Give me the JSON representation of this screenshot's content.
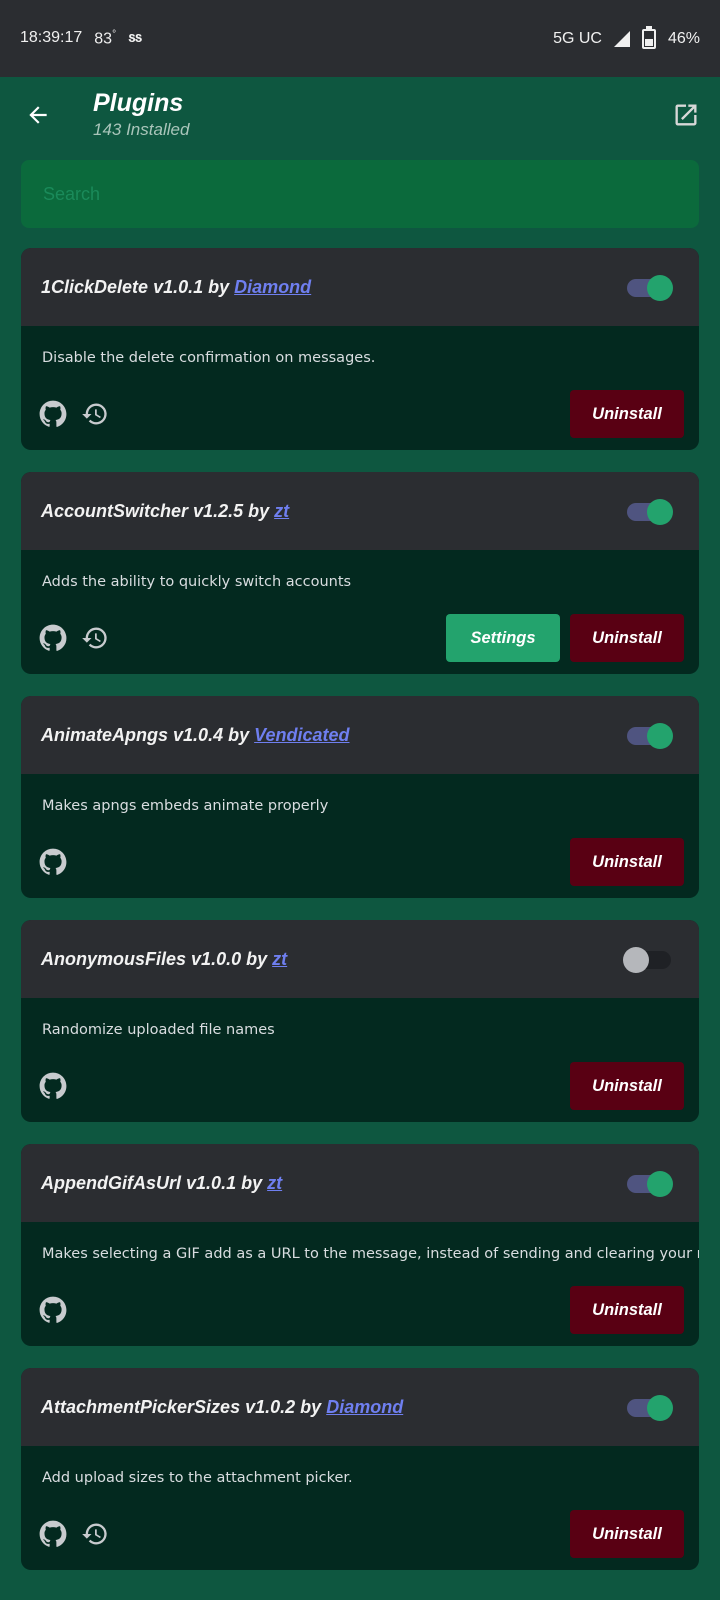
{
  "status_bar": {
    "time": "18:39:17",
    "temperature": "83",
    "degree": "°",
    "extra": "ՏՏ",
    "network": "5G UC",
    "battery": "46%"
  },
  "header": {
    "back_icon": "arrow-left-icon",
    "title": "Plugins",
    "subtitle": "143 Installed",
    "open_icon": "open-external-icon"
  },
  "search": {
    "placeholder": "Search",
    "value": ""
  },
  "colors": {
    "background": "#0e5740",
    "card_header": "#2b2d31",
    "card_body": "#03291f",
    "accent_green": "#23a36d",
    "danger": "#590013",
    "link": "#6f7ff0"
  },
  "plugins": [
    {
      "name": "1ClickDelete",
      "version": "v1.0.1",
      "by": "by",
      "author": "Diamond",
      "enabled": true,
      "description": "Disable the delete confirmation on messages.",
      "icons": [
        "github-icon",
        "history-icon"
      ],
      "settings_label": null,
      "uninstall_label": "Uninstall"
    },
    {
      "name": "AccountSwitcher",
      "version": "v1.2.5",
      "by": "by",
      "author": "zt",
      "enabled": true,
      "description": "Adds the ability to quickly switch accounts",
      "icons": [
        "github-icon",
        "history-icon"
      ],
      "settings_label": "Settings",
      "uninstall_label": "Uninstall"
    },
    {
      "name": "AnimateApngs",
      "version": "v1.0.4",
      "by": "by",
      "author": "Vendicated",
      "enabled": true,
      "description": "Makes apngs embeds animate properly",
      "icons": [
        "github-icon"
      ],
      "settings_label": null,
      "uninstall_label": "Uninstall"
    },
    {
      "name": "AnonymousFiles",
      "version": "v1.0.0",
      "by": "by",
      "author": "zt",
      "enabled": false,
      "description": "Randomize uploaded file names",
      "icons": [
        "github-icon"
      ],
      "settings_label": null,
      "uninstall_label": "Uninstall"
    },
    {
      "name": "AppendGifAsUrl",
      "version": "v1.0.1",
      "by": "by",
      "author": "zt",
      "enabled": true,
      "description": "Makes selecting a GIF add as a URL to the message, instead of sending and clearing your message.",
      "icons": [
        "github-icon"
      ],
      "settings_label": null,
      "uninstall_label": "Uninstall"
    },
    {
      "name": "AttachmentPickerSizes",
      "version": "v1.0.2",
      "by": "by",
      "author": "Diamond",
      "enabled": true,
      "description": "Add upload sizes to the attachment picker.",
      "icons": [
        "github-icon",
        "history-icon"
      ],
      "settings_label": null,
      "uninstall_label": "Uninstall"
    }
  ]
}
